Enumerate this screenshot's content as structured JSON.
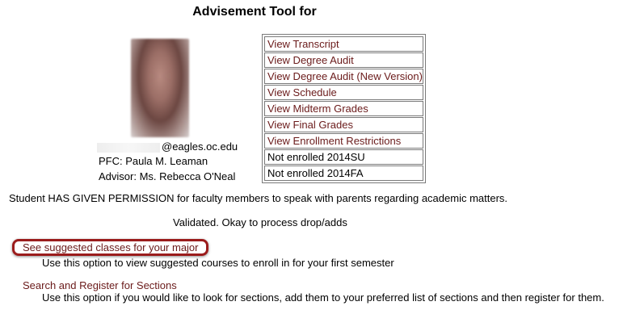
{
  "page": {
    "title": "Advisement Tool for"
  },
  "student": {
    "email_suffix": "@eagles.oc.edu",
    "pfc": "PFC: Paula M. Leaman",
    "advisor": "Advisor: Ms. Rebecca O'Neal"
  },
  "links": [
    {
      "label": "View Transcript",
      "kind": "link"
    },
    {
      "label": "View Degree Audit",
      "kind": "link"
    },
    {
      "label": "View Degree Audit (New Version)",
      "kind": "link"
    },
    {
      "label": "View Schedule",
      "kind": "link"
    },
    {
      "label": "View Midterm Grades",
      "kind": "link"
    },
    {
      "label": "View Final Grades",
      "kind": "link"
    },
    {
      "label": "View Enrollment Restrictions",
      "kind": "link"
    },
    {
      "label": "Not enrolled 2014SU",
      "kind": "text"
    },
    {
      "label": "Not enrolled 2014FA",
      "kind": "text"
    }
  ],
  "messages": {
    "permission": "Student HAS GIVEN PERMISSION for faculty members to speak with parents regarding academic matters.",
    "validated": "Validated. Okay to process drop/adds"
  },
  "options": {
    "suggested_label": "See suggested classes for your major",
    "suggested_desc": "Use this option to view suggested courses to enroll in for your first semester",
    "search_label": "Search and Register for Sections",
    "search_desc": "Use this option if you would like to look for sections, add them to your preferred list of sections and then register for them."
  },
  "colors": {
    "link": "#6a1a1a",
    "highlight_border": "#9b1c1c"
  }
}
